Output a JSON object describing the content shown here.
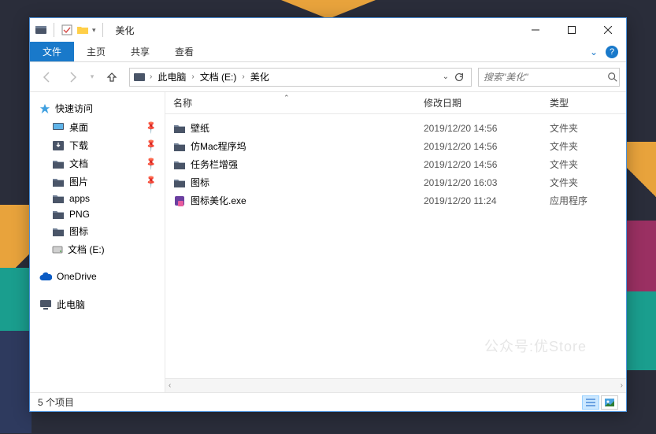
{
  "window": {
    "title": "美化",
    "watermark": "公众号:优Store"
  },
  "ribbon": {
    "tabs": [
      "文件",
      "主页",
      "共享",
      "查看"
    ],
    "active": 0
  },
  "nav": {
    "breadcrumb": [
      "此电脑",
      "文档 (E:)",
      "美化"
    ],
    "search_placeholder": "搜索\"美化\""
  },
  "sidebar": {
    "quick_access": "快速访问",
    "quick_items": [
      {
        "label": "桌面",
        "pinned": true,
        "icon": "desktop"
      },
      {
        "label": "下载",
        "pinned": true,
        "icon": "download"
      },
      {
        "label": "文档",
        "pinned": true,
        "icon": "folder"
      },
      {
        "label": "图片",
        "pinned": true,
        "icon": "folder"
      },
      {
        "label": "apps",
        "pinned": false,
        "icon": "folder"
      },
      {
        "label": "PNG",
        "pinned": false,
        "icon": "folder"
      },
      {
        "label": "图标",
        "pinned": false,
        "icon": "folder"
      },
      {
        "label": "文档 (E:)",
        "pinned": false,
        "icon": "disk"
      }
    ],
    "onedrive": "OneDrive",
    "this_pc": "此电脑"
  },
  "columns": {
    "name": "名称",
    "date": "修改日期",
    "type": "类型"
  },
  "files": [
    {
      "name": "壁纸",
      "date": "2019/12/20 14:56",
      "type": "文件夹",
      "icon": "folder"
    },
    {
      "name": "仿Mac程序坞",
      "date": "2019/12/20 14:56",
      "type": "文件夹",
      "icon": "folder"
    },
    {
      "name": "任务栏增强",
      "date": "2019/12/20 14:56",
      "type": "文件夹",
      "icon": "folder"
    },
    {
      "name": "图标",
      "date": "2019/12/20 16:03",
      "type": "文件夹",
      "icon": "folder"
    },
    {
      "name": "图标美化.exe",
      "date": "2019/12/20 11:24",
      "type": "应用程序",
      "icon": "exe"
    }
  ],
  "status": {
    "text": "5 个项目"
  }
}
